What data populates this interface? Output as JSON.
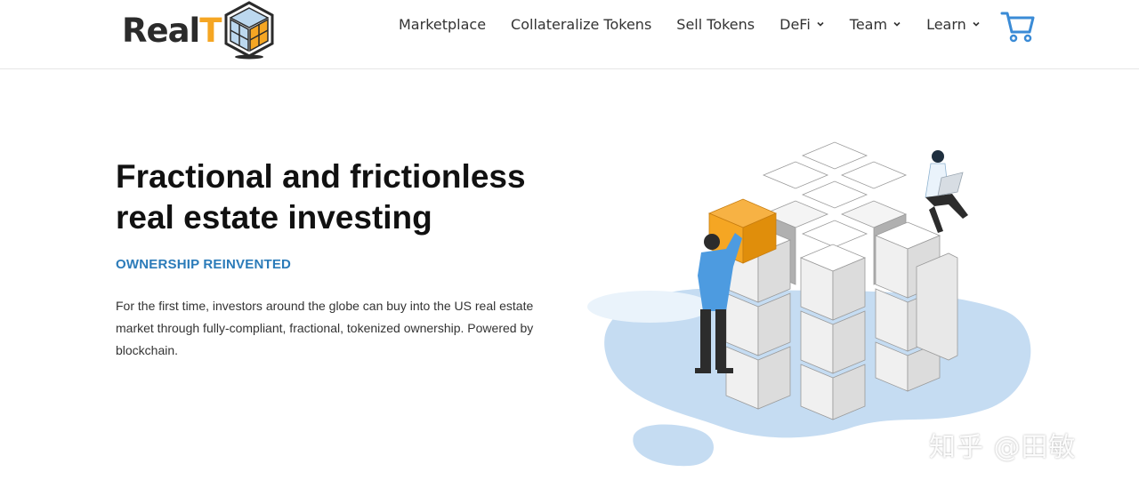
{
  "header": {
    "logo": {
      "text_main": "Real",
      "text_accent": "T"
    },
    "nav": [
      {
        "label": "Marketplace",
        "has_dropdown": false
      },
      {
        "label": "Collateralize Tokens",
        "has_dropdown": false
      },
      {
        "label": "Sell Tokens",
        "has_dropdown": false
      },
      {
        "label": "DeFi",
        "has_dropdown": true
      },
      {
        "label": "Team",
        "has_dropdown": true
      },
      {
        "label": "Learn",
        "has_dropdown": true
      }
    ],
    "cart_icon": "shopping-cart-icon"
  },
  "hero": {
    "title": "Fractional and frictionless real estate investing",
    "subtitle": "OWNERSHIP REINVENTED",
    "description": "For the first time, investors around the globe can buy into the US real estate market through fully-compliant, fractional, tokenized ownership. Powered by blockchain."
  },
  "watermark": "知乎 @田敏",
  "colors": {
    "accent": "#f5a623",
    "subtitle_blue": "#2b7bb9",
    "cart_blue": "#3a8bd6",
    "blob_blue": "#c5dcf2"
  }
}
